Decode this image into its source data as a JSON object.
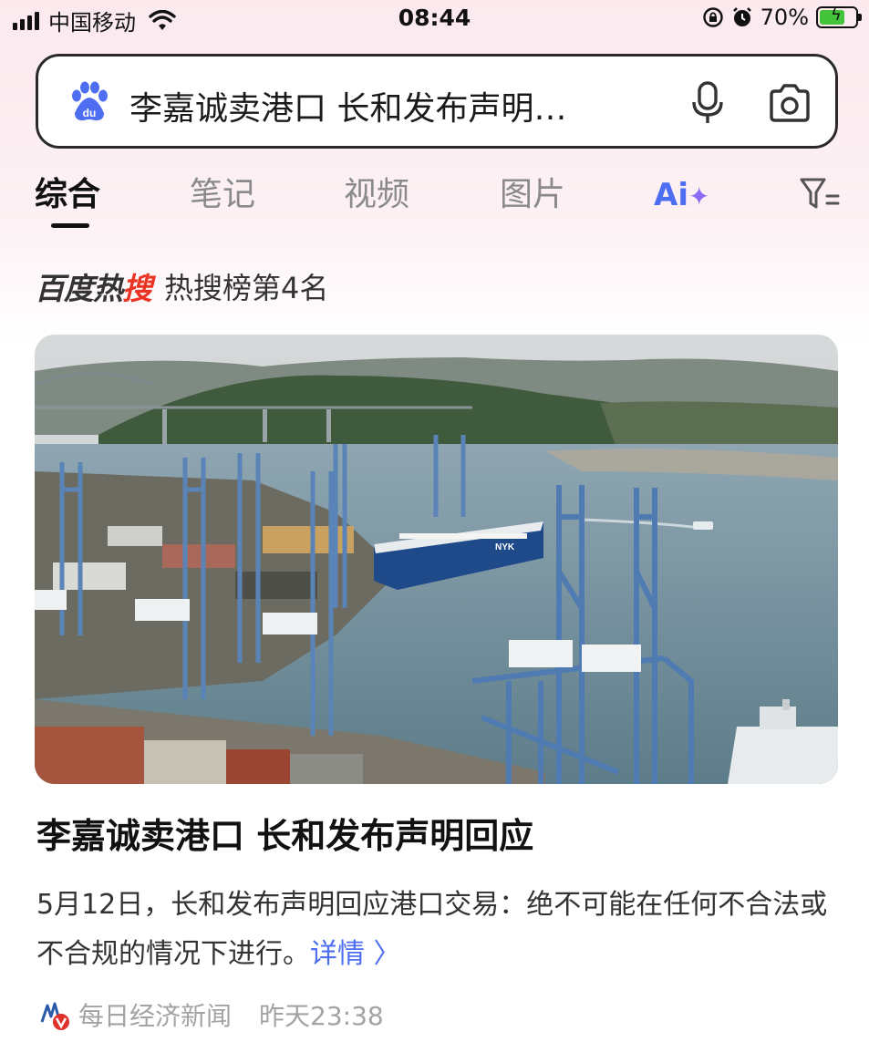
{
  "status_bar": {
    "carrier": "中国移动",
    "time": "08:44",
    "battery": "70%",
    "battery_level": 0.7
  },
  "search": {
    "query": "李嘉诚卖港口 长和发布声明…"
  },
  "tabs": [
    {
      "label": "综合",
      "active": true
    },
    {
      "label": "笔记",
      "active": false
    },
    {
      "label": "视频",
      "active": false
    },
    {
      "label": "图片",
      "active": false
    }
  ],
  "ai_tab": {
    "label": "Ai",
    "spark": "✦"
  },
  "hot_search": {
    "logo_black": "百度热",
    "logo_red": "搜",
    "rank_text": "热搜榜第4名"
  },
  "news": {
    "title": "李嘉诚卖港口 长和发布声明回应",
    "summary": "5月12日，长和发布声明回应港口交易：绝不可能在任何不合法或不合规的情况下进行。",
    "detail_link": "详情 〉",
    "source": "每日经济新闻",
    "time": "昨天23:38"
  },
  "colors": {
    "accent": "#4e6ef2",
    "hot_red": "#ea3323",
    "ship_blue": "#1f4a8a"
  }
}
